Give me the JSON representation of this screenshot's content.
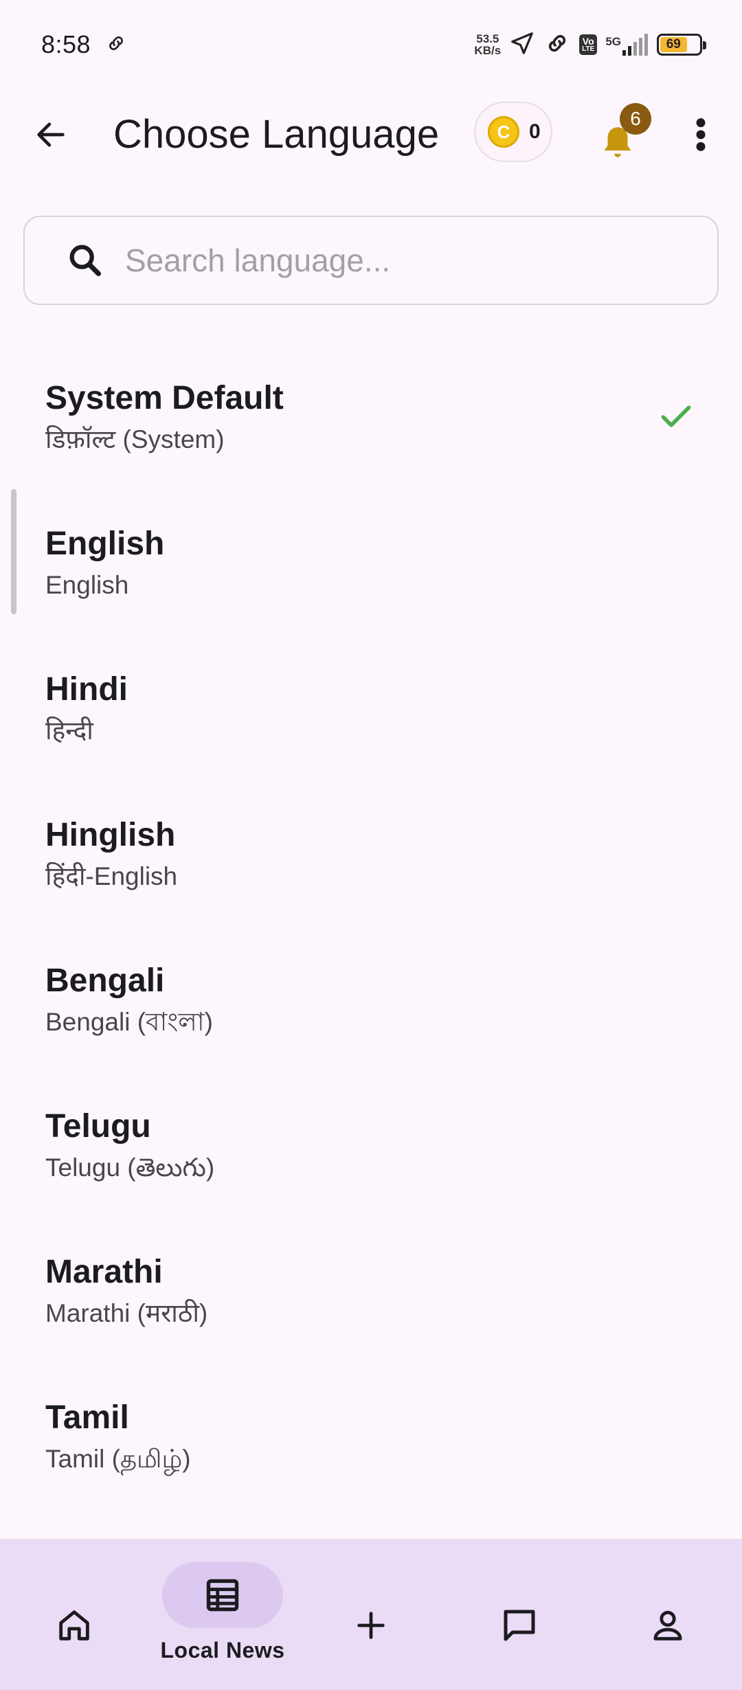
{
  "status_bar": {
    "time": "8:58",
    "net_speed_value": "53.5",
    "net_speed_unit": "KB/s",
    "volte_line1": "Vo",
    "volte_line2": "LTE",
    "network": "5G",
    "battery": "69",
    "battery_level": 0.69,
    "battery_color": "#f5b731"
  },
  "app_bar": {
    "title": "Choose Language",
    "coin_count": "0",
    "coin_symbol": "C",
    "notification_count": "6"
  },
  "search": {
    "placeholder": "Search language...",
    "value": ""
  },
  "languages": [
    {
      "name": "System Default",
      "native": "डिफ़ॉल्ट (System)",
      "selected": true
    },
    {
      "name": "English",
      "native": "English",
      "selected": false
    },
    {
      "name": "Hindi",
      "native": "हिन्दी",
      "selected": false
    },
    {
      "name": "Hinglish",
      "native": "हिंदी-English",
      "selected": false
    },
    {
      "name": "Bengali",
      "native": "Bengali (বাংলা)",
      "selected": false
    },
    {
      "name": "Telugu",
      "native": "Telugu (తెలుగు)",
      "selected": false
    },
    {
      "name": "Marathi",
      "native": "Marathi (मराठी)",
      "selected": false
    },
    {
      "name": "Tamil",
      "native": "Tamil (தமிழ்)",
      "selected": false
    }
  ],
  "bottom_nav": {
    "items": [
      {
        "icon": "home-icon",
        "label": ""
      },
      {
        "icon": "news-icon",
        "label": "Local News",
        "active": true
      },
      {
        "icon": "plus-icon",
        "label": ""
      },
      {
        "icon": "chat-icon",
        "label": ""
      },
      {
        "icon": "profile-icon",
        "label": ""
      }
    ]
  },
  "colors": {
    "background": "#fdf7fd",
    "check": "#4caf50",
    "bell": "#c8960c",
    "badge": "#8a5a10",
    "nav_bg": "#eadcf7",
    "nav_active": "#dcc9ef"
  }
}
